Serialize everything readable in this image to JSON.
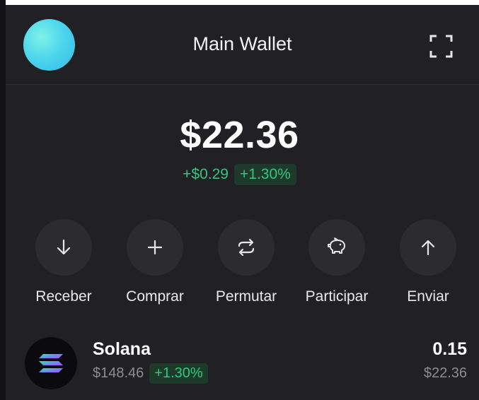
{
  "header": {
    "title": "Main Wallet",
    "avatar_colors": [
      "#7ff2e8",
      "#33b9e6"
    ],
    "expand_icon": "expand-icon"
  },
  "balance": {
    "total": "$22.36",
    "change_abs": "+$0.29",
    "change_pct": "+1.30%"
  },
  "actions": [
    {
      "label": "Receber",
      "icon": "arrow-down-icon"
    },
    {
      "label": "Comprar",
      "icon": "plus-icon"
    },
    {
      "label": "Permutar",
      "icon": "swap-icon"
    },
    {
      "label": "Participar",
      "icon": "piggy-bank-icon"
    },
    {
      "label": "Enviar",
      "icon": "arrow-up-icon"
    }
  ],
  "tokens": [
    {
      "name": "Solana",
      "price": "$148.46",
      "change_pct": "+1.30%",
      "amount": "0.15",
      "value": "$22.36",
      "icon": "solana-logo-icon"
    }
  ],
  "colors": {
    "background": "#212125",
    "positive": "#2ec97c",
    "muted": "#8c8c92",
    "button": "#2c2c30"
  }
}
